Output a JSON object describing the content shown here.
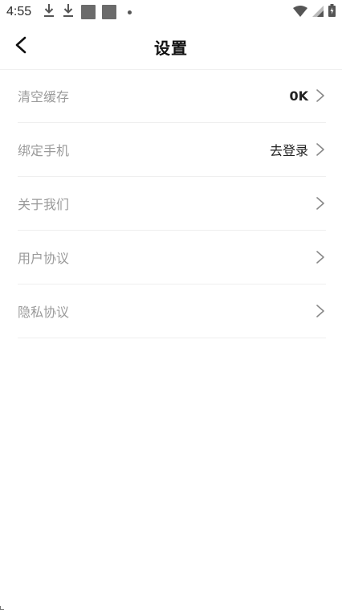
{
  "status_bar": {
    "time": "4:55",
    "icons": [
      "download-icon",
      "download-icon",
      "app-notification-icon",
      "app-notification-icon",
      "dot-icon",
      "wifi-icon",
      "signal-icon",
      "battery-icon"
    ]
  },
  "header": {
    "title": "设置",
    "back_icon": "chevron-left-icon"
  },
  "settings": {
    "items": [
      {
        "label": "清空缓存",
        "value": "0K"
      },
      {
        "label": "绑定手机",
        "value": "去登录"
      },
      {
        "label": "关于我们",
        "value": ""
      },
      {
        "label": "用户协议",
        "value": ""
      },
      {
        "label": "隐私协议",
        "value": ""
      }
    ]
  },
  "colors": {
    "label_text": "#9a9a9a",
    "value_text": "#222222",
    "divider": "#efefef",
    "background": "#ffffff"
  }
}
